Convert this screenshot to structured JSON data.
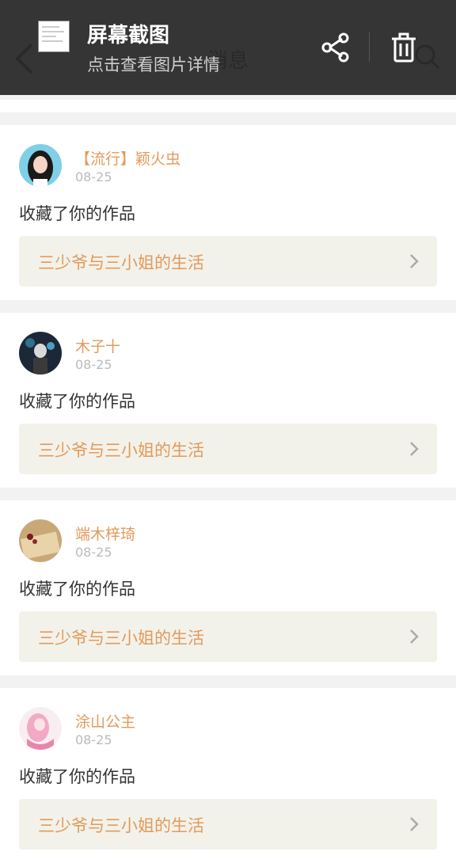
{
  "app": {
    "title": "消息"
  },
  "overlay": {
    "title": "屏幕截图",
    "subtitle": "点击查看图片详情"
  },
  "messages": [
    {
      "user": "【流行】颖火虫",
      "date": "08-25",
      "action": "收藏了你的作品",
      "work": "三少爷与三小姐的生活"
    },
    {
      "user": "木子十",
      "date": "08-25",
      "action": "收藏了你的作品",
      "work": "三少爷与三小姐的生活"
    },
    {
      "user": "端木梓琦",
      "date": "08-25",
      "action": "收藏了你的作品",
      "work": "三少爷与三小姐的生活"
    },
    {
      "user": "涂山公主",
      "date": "08-25",
      "action": "收藏了你的作品",
      "work": "三少爷与三小姐的生活"
    }
  ],
  "colors": {
    "accent": "#e39a5b",
    "overlay_bg": "#282828",
    "link_bg": "#f2f2ea"
  },
  "icons": [
    "back-arrow-icon",
    "search-icon",
    "share-icon",
    "trash-icon",
    "chevron-right-icon"
  ]
}
